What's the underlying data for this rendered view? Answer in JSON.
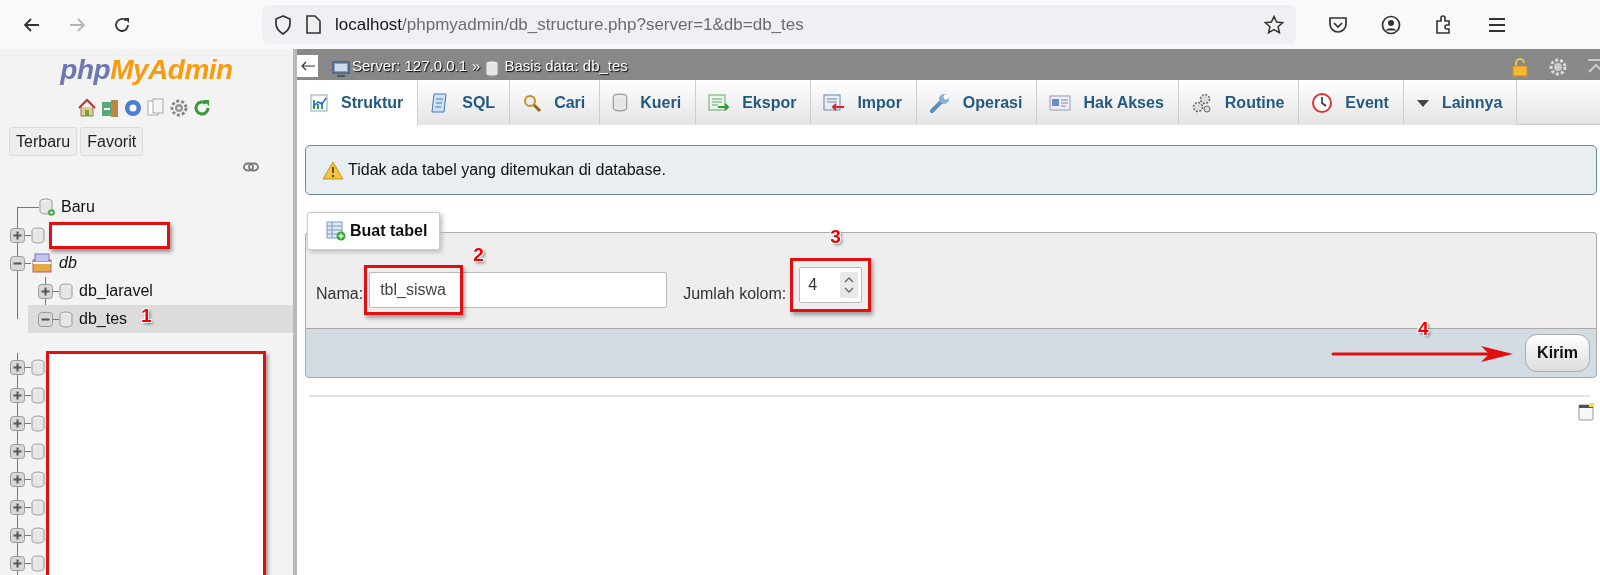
{
  "browser": {
    "url_host": "localhost",
    "url_path": "/phpmyadmin/db_structure.php?server=1&db=db_tes",
    "forward_disabled": true
  },
  "sidebar": {
    "logo": [
      "php",
      "MyAdmin"
    ],
    "buttons": [
      "Terbaru",
      "Favorit"
    ],
    "tree": [
      {
        "kind": "new",
        "label": "Baru",
        "selected": false
      },
      {
        "kind": "database",
        "redacted": true,
        "expanded": false,
        "selected": false
      },
      {
        "kind": "group",
        "label": "db",
        "expanded": true,
        "selected": false,
        "children": [
          {
            "kind": "database",
            "label": "db_laravel",
            "expanded": false,
            "selected": false
          },
          {
            "kind": "database",
            "label": "db_tes",
            "expanded": true,
            "selected": true,
            "marker": "1"
          }
        ]
      }
    ],
    "tree_more": {
      "redacted": true,
      "items": [
        {
          "kind": "database",
          "expanded": false,
          "selected": false
        },
        {
          "kind": "database",
          "expanded": false,
          "selected": false
        },
        {
          "kind": "database",
          "expanded": false,
          "selected": false
        },
        {
          "kind": "database",
          "expanded": false,
          "selected": false
        },
        {
          "kind": "database",
          "expanded": false,
          "selected": false
        },
        {
          "kind": "database",
          "expanded": false,
          "selected": false
        },
        {
          "kind": "database",
          "expanded": false,
          "selected": false
        },
        {
          "kind": "database",
          "expanded": false,
          "selected": false
        }
      ]
    }
  },
  "breadcrumb": [
    "Server: 127.0.0.1",
    "»",
    "Basis data: db_tes"
  ],
  "tabs": [
    {
      "label": "Struktur",
      "selected": true
    },
    {
      "label": "SQL",
      "selected": false
    },
    {
      "label": "Cari",
      "selected": false
    },
    {
      "label": "Kueri",
      "selected": false
    },
    {
      "label": "Ekspor",
      "selected": false
    },
    {
      "label": "Impor",
      "selected": false
    },
    {
      "label": "Operasi",
      "selected": false
    },
    {
      "label": "Hak Akses",
      "selected": false
    },
    {
      "label": "Routine",
      "selected": false
    },
    {
      "label": "Event",
      "selected": false
    },
    {
      "label": "Lainnya",
      "selected": false
    }
  ],
  "notice": {
    "kind": "warning",
    "text": "Tidak ada tabel yang ditemukan di database."
  },
  "create_table": {
    "legend": "Buat tabel",
    "name_label": "Nama:",
    "name_value": "tbl_siswa",
    "name_highlighted": true,
    "name_marker": "2",
    "columns_label": "Jumlah kolom:",
    "columns_value": "4",
    "columns_highlighted": true,
    "columns_marker": "3",
    "submit": "Kirim",
    "submit_marker": "4",
    "submit_arrow": true
  }
}
